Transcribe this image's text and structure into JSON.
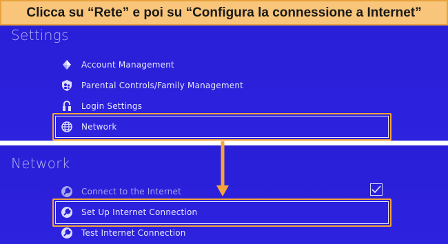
{
  "caption": {
    "text": "Clicca su “Rete” e poi su “Configura la connessione a Internet”"
  },
  "settings_screen": {
    "title": "Settings",
    "items": [
      {
        "label": "Account Management",
        "icon": "account-icon"
      },
      {
        "label": "Parental Controls/Family Management",
        "icon": "parental-controls-icon"
      },
      {
        "label": "Login Settings",
        "icon": "login-icon"
      },
      {
        "label": "Network",
        "icon": "globe-icon",
        "highlighted": true
      }
    ]
  },
  "network_screen": {
    "title": "Network",
    "items": [
      {
        "label": "Connect to the Internet",
        "icon": "wrench-icon",
        "checked": true
      },
      {
        "label": "Set Up Internet Connection",
        "icon": "wrench-icon",
        "highlighted": true
      },
      {
        "label": "Test Internet Connection",
        "icon": "wrench-icon"
      }
    ]
  },
  "colors": {
    "panel_bg": "#2a1fd8",
    "highlight": "#f5a33a",
    "caption_bg": "#f8c57a",
    "arrow": "#f5a33a"
  }
}
